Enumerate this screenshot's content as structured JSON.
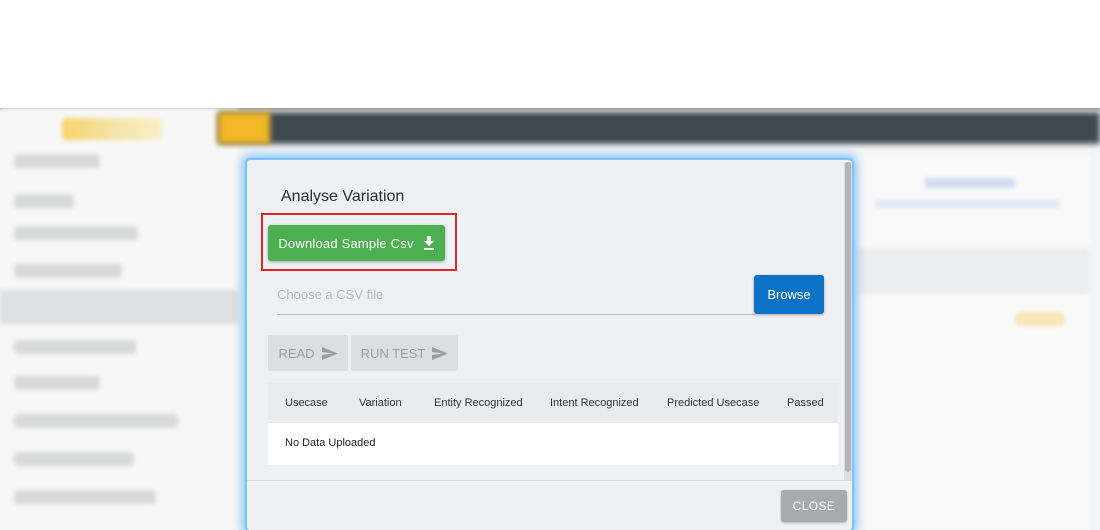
{
  "modal": {
    "title": "Analyse Variation",
    "download_button": {
      "label": "Download Sample Csv",
      "icon": "download-icon"
    },
    "file_input": {
      "placeholder": "Choose a CSV file",
      "value": ""
    },
    "browse_button": {
      "label": "Browse"
    },
    "read_button": {
      "label": "READ",
      "icon": "send-icon",
      "disabled": true
    },
    "run_test_button": {
      "label": "RUN TEST",
      "icon": "send-icon",
      "disabled": true
    },
    "table": {
      "headers": [
        "Usecase",
        "Variation",
        "Entity Recognized",
        "Intent Recognized",
        "Predicted Usecase",
        "Passed"
      ],
      "empty_message": "No Data Uploaded"
    },
    "close_button": {
      "label": "CLOSE"
    }
  },
  "colors": {
    "download_green": "#4caf50",
    "browse_blue": "#0b72c7",
    "highlight_red": "#e0262b",
    "modal_glow": "#7cc3f7"
  }
}
